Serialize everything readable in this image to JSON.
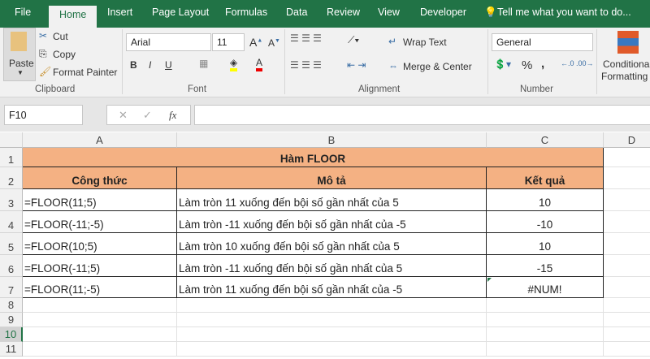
{
  "tabs": [
    "File",
    "Home",
    "Insert",
    "Page Layout",
    "Formulas",
    "Data",
    "Review",
    "View",
    "Developer"
  ],
  "tell_me": "Tell me what you want to do...",
  "clipboard": {
    "paste": "Paste",
    "cut": "Cut",
    "copy": "Copy",
    "format_painter": "Format Painter",
    "label": "Clipboard"
  },
  "font": {
    "name": "Arial",
    "size": "11",
    "label": "Font",
    "bold": "B",
    "italic": "I",
    "underline": "U",
    "color_a": "A"
  },
  "alignment": {
    "wrap": "Wrap Text",
    "merge": "Merge & Center",
    "label": "Alignment"
  },
  "number": {
    "format": "General",
    "percent": "%",
    "comma": ",",
    "label": "Number"
  },
  "styles": {
    "conditional": "Conditional",
    "formatting": "Formatting"
  },
  "formula_bar": {
    "name_box": "F10",
    "fx": "fx",
    "cancel": "✕",
    "enter": "✓",
    "value": ""
  },
  "columns": [
    "A",
    "B",
    "C",
    "D"
  ],
  "rows": [
    "1",
    "2",
    "3",
    "4",
    "5",
    "6",
    "7",
    "8",
    "9",
    "10",
    "11"
  ],
  "sheet": {
    "title": "Hàm FLOOR",
    "headers": [
      "Công thức",
      "Mô tả",
      "Kết quả"
    ],
    "data": [
      [
        "=FLOOR(11;5)",
        "Làm tròn 11 xuống đến bội số gần nhất của 5",
        "10"
      ],
      [
        "=FLOOR(-11;-5)",
        "Làm tròn -11 xuống đến bội số gần nhất của -5",
        "-10"
      ],
      [
        "=FLOOR(10;5)",
        "Làm tròn 10 xuống đến bội số gần nhất của 5",
        "10"
      ],
      [
        "=FLOOR(-11;5)",
        "Làm tròn -11 xuống đến bội số gần nhất của 5",
        "-15"
      ],
      [
        "=FLOOR(11;-5)",
        "Làm tròn 11 xuống đến bội số gần nhất của -5",
        "#NUM!"
      ]
    ]
  },
  "colors": {
    "accent": "#217346",
    "header_fill": "#f4b183"
  }
}
